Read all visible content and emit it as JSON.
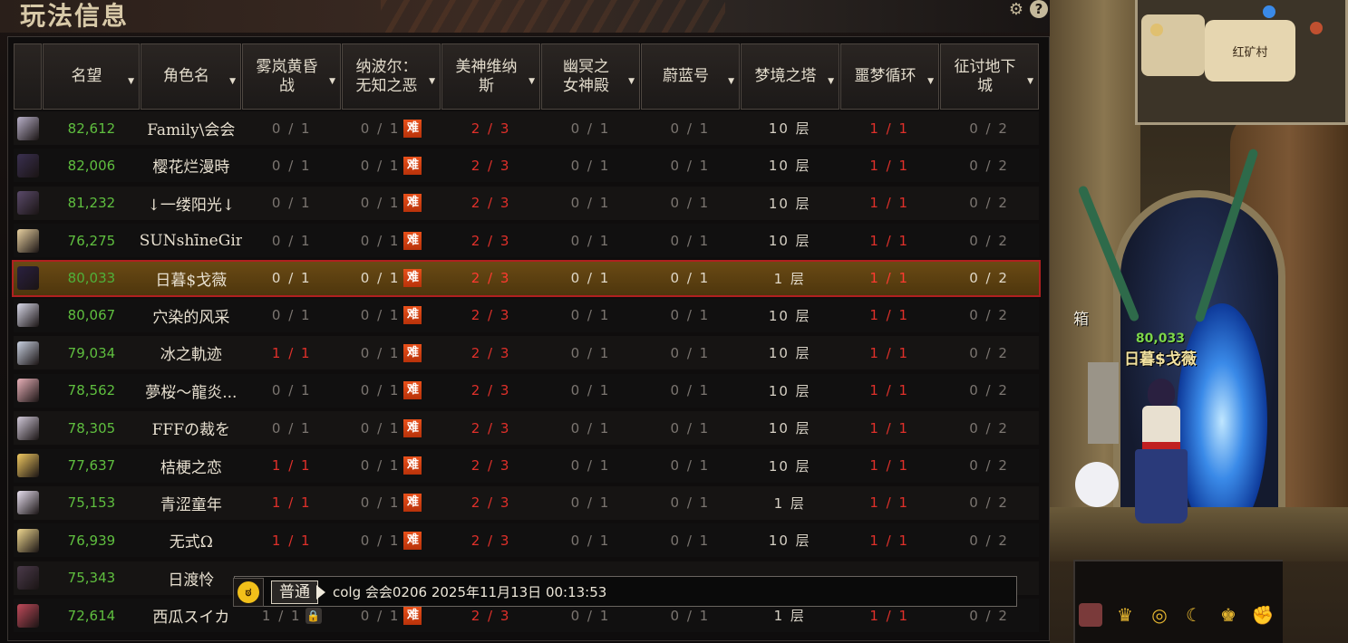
{
  "title": "玩法信息",
  "title_icons": [
    {
      "name": "gear-icon",
      "glyph": "⚙"
    },
    {
      "name": "help-icon",
      "glyph": "?"
    }
  ],
  "columns": [
    {
      "key": "avatar",
      "label": ""
    },
    {
      "key": "fame",
      "label": "名望"
    },
    {
      "key": "name",
      "label": "角色名"
    },
    {
      "key": "d1",
      "label": "雾岚黄昏\n战"
    },
    {
      "key": "d2",
      "label": "纳波尔：\n无知之恶"
    },
    {
      "key": "d3",
      "label": "美神维纳\n斯"
    },
    {
      "key": "d4",
      "label": "幽冥之\n女神殿"
    },
    {
      "key": "d5",
      "label": "蔚蓝号"
    },
    {
      "key": "d6",
      "label": "梦境之塔"
    },
    {
      "key": "d7",
      "label": "噩梦循环"
    },
    {
      "key": "d8",
      "label": "征讨地下\n城"
    }
  ],
  "hard_badge": "难",
  "rows": [
    {
      "avatar_color": "#b8b0c8",
      "fame": "82,612",
      "name": "Family\\会会",
      "d1": "0 / 1",
      "d1_red": false,
      "d2": "0 / 1",
      "d2_badge": "hard",
      "d3": "2 / 3",
      "d4": "0 / 1",
      "d5": "0 / 1",
      "d6": "10 层",
      "d7": "1 / 1",
      "d8": "0 / 2"
    },
    {
      "avatar_color": "#3a3050",
      "fame": "82,006",
      "name": "樱花烂漫時",
      "d1": "0 / 1",
      "d1_red": false,
      "d2": "0 / 1",
      "d2_badge": "hard",
      "d3": "2 / 3",
      "d4": "0 / 1",
      "d5": "0 / 1",
      "d6": "10 层",
      "d7": "1 / 1",
      "d8": "0 / 2"
    },
    {
      "avatar_color": "#5a4a6a",
      "fame": "81,232",
      "name": "↓一缕阳光↓",
      "d1": "0 / 1",
      "d1_red": false,
      "d2": "0 / 1",
      "d2_badge": "hard",
      "d3": "2 / 3",
      "d4": "0 / 1",
      "d5": "0 / 1",
      "d6": "10 层",
      "d7": "1 / 1",
      "d8": "0 / 2"
    },
    {
      "avatar_color": "#e8d0a0",
      "fame": "76,275",
      "name": "SUNshīneGir",
      "d1": "0 / 1",
      "d1_red": false,
      "d2": "0 / 1",
      "d2_badge": "hard",
      "d3": "2 / 3",
      "d4": "0 / 1",
      "d5": "0 / 1",
      "d6": "10 层",
      "d7": "1 / 1",
      "d8": "0 / 2"
    },
    {
      "avatar_color": "#2a2040",
      "fame": "80,033",
      "name": "日暮$戈薇",
      "d1": "0 / 1",
      "d1_red": false,
      "d2": "0 / 1",
      "d2_badge": "hard",
      "d3": "2 / 3",
      "d4": "0 / 1",
      "d5": "0 / 1",
      "d6": "1 层",
      "d7": "1 / 1",
      "d8": "0 / 2",
      "selected": true
    },
    {
      "avatar_color": "#d8d8e8",
      "fame": "80,067",
      "name": "穴染的风采",
      "d1": "0 / 1",
      "d1_red": false,
      "d2": "0 / 1",
      "d2_badge": "hard",
      "d3": "2 / 3",
      "d4": "0 / 1",
      "d5": "0 / 1",
      "d6": "10 层",
      "d7": "1 / 1",
      "d8": "0 / 2"
    },
    {
      "avatar_color": "#c8d0e0",
      "fame": "79,034",
      "name": "冰之軌迹",
      "d1": "1 / 1",
      "d1_red": true,
      "d2": "0 / 1",
      "d2_badge": "hard",
      "d3": "2 / 3",
      "d4": "0 / 1",
      "d5": "0 / 1",
      "d6": "10 层",
      "d7": "1 / 1",
      "d8": "0 / 2"
    },
    {
      "avatar_color": "#e8b0b8",
      "fame": "78,562",
      "name": "夢桜～龍炎...",
      "d1": "0 / 1",
      "d1_red": false,
      "d2": "0 / 1",
      "d2_badge": "hard",
      "d3": "2 / 3",
      "d4": "0 / 1",
      "d5": "0 / 1",
      "d6": "10 层",
      "d7": "1 / 1",
      "d8": "0 / 2"
    },
    {
      "avatar_color": "#d0c8d8",
      "fame": "78,305",
      "name": "FFFの裁を",
      "d1": "0 / 1",
      "d1_red": false,
      "d2": "0 / 1",
      "d2_badge": "hard",
      "d3": "2 / 3",
      "d4": "0 / 1",
      "d5": "0 / 1",
      "d6": "10 层",
      "d7": "1 / 1",
      "d8": "0 / 2"
    },
    {
      "avatar_color": "#f0c860",
      "fame": "77,637",
      "name": "桔梗之恋",
      "d1": "1 / 1",
      "d1_red": true,
      "d2": "0 / 1",
      "d2_badge": "hard",
      "d3": "2 / 3",
      "d4": "0 / 1",
      "d5": "0 / 1",
      "d6": "10 层",
      "d7": "1 / 1",
      "d8": "0 / 2"
    },
    {
      "avatar_color": "#e8e0f0",
      "fame": "75,153",
      "name": "青涩童年",
      "d1": "1 / 1",
      "d1_red": true,
      "d2": "0 / 1",
      "d2_badge": "hard",
      "d3": "2 / 3",
      "d4": "0 / 1",
      "d5": "0 / 1",
      "d6": "1 层",
      "d7": "1 / 1",
      "d8": "0 / 2"
    },
    {
      "avatar_color": "#f0d890",
      "fame": "76,939",
      "name": "无式Ω",
      "d1": "1 / 1",
      "d1_red": true,
      "d2": "0 / 1",
      "d2_badge": "hard",
      "d3": "2 / 3",
      "d4": "0 / 1",
      "d5": "0 / 1",
      "d6": "10 层",
      "d7": "1 / 1",
      "d8": "0 / 2"
    },
    {
      "avatar_color": "#4a3a4a",
      "fame": "75,343",
      "name": "日渡怜",
      "d1": "",
      "d1_red": false,
      "d2": "",
      "d2_badge": "",
      "d3": "",
      "d4": "",
      "d5": "",
      "d6": "",
      "d7": "",
      "d8": ""
    },
    {
      "avatar_color": "#c04a5a",
      "fame": "72,614",
      "name": "西瓜スイカ",
      "d1": "1 / 1",
      "d1_red": false,
      "d1_badge": "lock",
      "d2": "0 / 1",
      "d2_badge": "hard",
      "d3": "2 / 3",
      "d4": "0 / 1",
      "d5": "0 / 1",
      "d6": "1 层",
      "d7": "1 / 1",
      "d8": "0 / 2"
    }
  ],
  "chat": {
    "channel": "普通",
    "message": "colg 会会0206 2025年11月13日 00:13:53"
  },
  "scene": {
    "player_fame": "80,033",
    "player_name": "日暮$戈薇",
    "side_label": "箱",
    "minimap_label": "红矿村"
  },
  "colors": {
    "fame_green": "#5fbf3f",
    "done_red": "#e0302a",
    "hard_badge_orange": "#e8501a",
    "selected_outline": "#b02020"
  }
}
